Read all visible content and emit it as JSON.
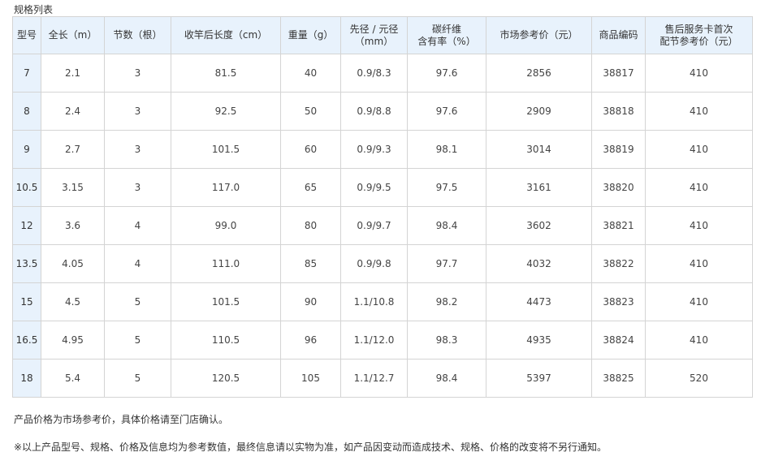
{
  "title": "规格列表",
  "headers": [
    "型号",
    "全长（m）",
    "节数（根）",
    "收竿后长度（cm）",
    "重量（g）",
    "先径 / 元径\n（mm）",
    "碳纤维\n含有率（%）",
    "市场参考价（元）",
    "商品编码",
    "售后服务卡首次\n配节参考价（元）"
  ],
  "rows": [
    [
      "7",
      "2.1",
      "3",
      "81.5",
      "40",
      "0.9/8.3",
      "97.6",
      "2856",
      "38817",
      "410"
    ],
    [
      "8",
      "2.4",
      "3",
      "92.5",
      "50",
      "0.9/8.8",
      "97.6",
      "2909",
      "38818",
      "410"
    ],
    [
      "9",
      "2.7",
      "3",
      "101.5",
      "60",
      "0.9/9.3",
      "98.1",
      "3014",
      "38819",
      "410"
    ],
    [
      "10.5",
      "3.15",
      "3",
      "117.0",
      "65",
      "0.9/9.5",
      "97.5",
      "3161",
      "38820",
      "410"
    ],
    [
      "12",
      "3.6",
      "4",
      "99.0",
      "80",
      "0.9/9.7",
      "98.4",
      "3602",
      "38821",
      "410"
    ],
    [
      "13.5",
      "4.05",
      "4",
      "111.0",
      "85",
      "0.9/9.8",
      "97.7",
      "4032",
      "38822",
      "410"
    ],
    [
      "15",
      "4.5",
      "5",
      "101.5",
      "90",
      "1.1/10.8",
      "98.2",
      "4473",
      "38823",
      "410"
    ],
    [
      "16.5",
      "4.95",
      "5",
      "110.5",
      "96",
      "1.1/12.0",
      "98.3",
      "4935",
      "38824",
      "410"
    ],
    [
      "18",
      "5.4",
      "5",
      "120.5",
      "105",
      "1.1/12.7",
      "98.4",
      "5397",
      "38825",
      "520"
    ]
  ],
  "notes": {
    "price_note": "产品价格为市场参考价，具体价格请至门店确认。",
    "disclaimer": "※以上产品型号、规格、价格及信息均为参考数值，最终信息请以实物为准，如产品因变动而造成技术、规格、价格的改变将不另行通知。"
  },
  "colors": {
    "header_bg": "#e8f2fc",
    "border": "#d4d4d4"
  }
}
